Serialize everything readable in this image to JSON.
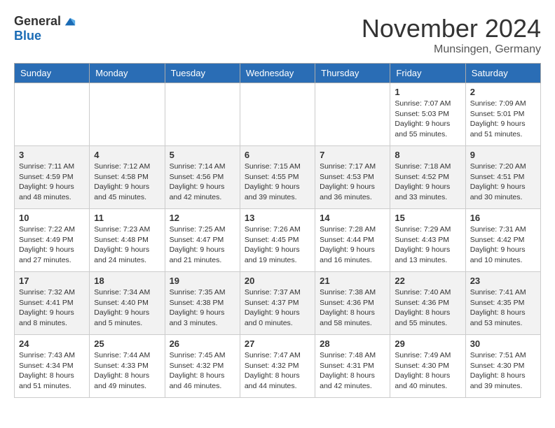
{
  "logo": {
    "general": "General",
    "blue": "Blue"
  },
  "header": {
    "month": "November 2024",
    "location": "Munsingen, Germany"
  },
  "weekdays": [
    "Sunday",
    "Monday",
    "Tuesday",
    "Wednesday",
    "Thursday",
    "Friday",
    "Saturday"
  ],
  "weeks": [
    [
      {
        "day": "",
        "info": ""
      },
      {
        "day": "",
        "info": ""
      },
      {
        "day": "",
        "info": ""
      },
      {
        "day": "",
        "info": ""
      },
      {
        "day": "",
        "info": ""
      },
      {
        "day": "1",
        "info": "Sunrise: 7:07 AM\nSunset: 5:03 PM\nDaylight: 9 hours and 55 minutes."
      },
      {
        "day": "2",
        "info": "Sunrise: 7:09 AM\nSunset: 5:01 PM\nDaylight: 9 hours and 51 minutes."
      }
    ],
    [
      {
        "day": "3",
        "info": "Sunrise: 7:11 AM\nSunset: 4:59 PM\nDaylight: 9 hours and 48 minutes."
      },
      {
        "day": "4",
        "info": "Sunrise: 7:12 AM\nSunset: 4:58 PM\nDaylight: 9 hours and 45 minutes."
      },
      {
        "day": "5",
        "info": "Sunrise: 7:14 AM\nSunset: 4:56 PM\nDaylight: 9 hours and 42 minutes."
      },
      {
        "day": "6",
        "info": "Sunrise: 7:15 AM\nSunset: 4:55 PM\nDaylight: 9 hours and 39 minutes."
      },
      {
        "day": "7",
        "info": "Sunrise: 7:17 AM\nSunset: 4:53 PM\nDaylight: 9 hours and 36 minutes."
      },
      {
        "day": "8",
        "info": "Sunrise: 7:18 AM\nSunset: 4:52 PM\nDaylight: 9 hours and 33 minutes."
      },
      {
        "day": "9",
        "info": "Sunrise: 7:20 AM\nSunset: 4:51 PM\nDaylight: 9 hours and 30 minutes."
      }
    ],
    [
      {
        "day": "10",
        "info": "Sunrise: 7:22 AM\nSunset: 4:49 PM\nDaylight: 9 hours and 27 minutes."
      },
      {
        "day": "11",
        "info": "Sunrise: 7:23 AM\nSunset: 4:48 PM\nDaylight: 9 hours and 24 minutes."
      },
      {
        "day": "12",
        "info": "Sunrise: 7:25 AM\nSunset: 4:47 PM\nDaylight: 9 hours and 21 minutes."
      },
      {
        "day": "13",
        "info": "Sunrise: 7:26 AM\nSunset: 4:45 PM\nDaylight: 9 hours and 19 minutes."
      },
      {
        "day": "14",
        "info": "Sunrise: 7:28 AM\nSunset: 4:44 PM\nDaylight: 9 hours and 16 minutes."
      },
      {
        "day": "15",
        "info": "Sunrise: 7:29 AM\nSunset: 4:43 PM\nDaylight: 9 hours and 13 minutes."
      },
      {
        "day": "16",
        "info": "Sunrise: 7:31 AM\nSunset: 4:42 PM\nDaylight: 9 hours and 10 minutes."
      }
    ],
    [
      {
        "day": "17",
        "info": "Sunrise: 7:32 AM\nSunset: 4:41 PM\nDaylight: 9 hours and 8 minutes."
      },
      {
        "day": "18",
        "info": "Sunrise: 7:34 AM\nSunset: 4:40 PM\nDaylight: 9 hours and 5 minutes."
      },
      {
        "day": "19",
        "info": "Sunrise: 7:35 AM\nSunset: 4:38 PM\nDaylight: 9 hours and 3 minutes."
      },
      {
        "day": "20",
        "info": "Sunrise: 7:37 AM\nSunset: 4:37 PM\nDaylight: 9 hours and 0 minutes."
      },
      {
        "day": "21",
        "info": "Sunrise: 7:38 AM\nSunset: 4:36 PM\nDaylight: 8 hours and 58 minutes."
      },
      {
        "day": "22",
        "info": "Sunrise: 7:40 AM\nSunset: 4:36 PM\nDaylight: 8 hours and 55 minutes."
      },
      {
        "day": "23",
        "info": "Sunrise: 7:41 AM\nSunset: 4:35 PM\nDaylight: 8 hours and 53 minutes."
      }
    ],
    [
      {
        "day": "24",
        "info": "Sunrise: 7:43 AM\nSunset: 4:34 PM\nDaylight: 8 hours and 51 minutes."
      },
      {
        "day": "25",
        "info": "Sunrise: 7:44 AM\nSunset: 4:33 PM\nDaylight: 8 hours and 49 minutes."
      },
      {
        "day": "26",
        "info": "Sunrise: 7:45 AM\nSunset: 4:32 PM\nDaylight: 8 hours and 46 minutes."
      },
      {
        "day": "27",
        "info": "Sunrise: 7:47 AM\nSunset: 4:32 PM\nDaylight: 8 hours and 44 minutes."
      },
      {
        "day": "28",
        "info": "Sunrise: 7:48 AM\nSunset: 4:31 PM\nDaylight: 8 hours and 42 minutes."
      },
      {
        "day": "29",
        "info": "Sunrise: 7:49 AM\nSunset: 4:30 PM\nDaylight: 8 hours and 40 minutes."
      },
      {
        "day": "30",
        "info": "Sunrise: 7:51 AM\nSunset: 4:30 PM\nDaylight: 8 hours and 39 minutes."
      }
    ]
  ]
}
